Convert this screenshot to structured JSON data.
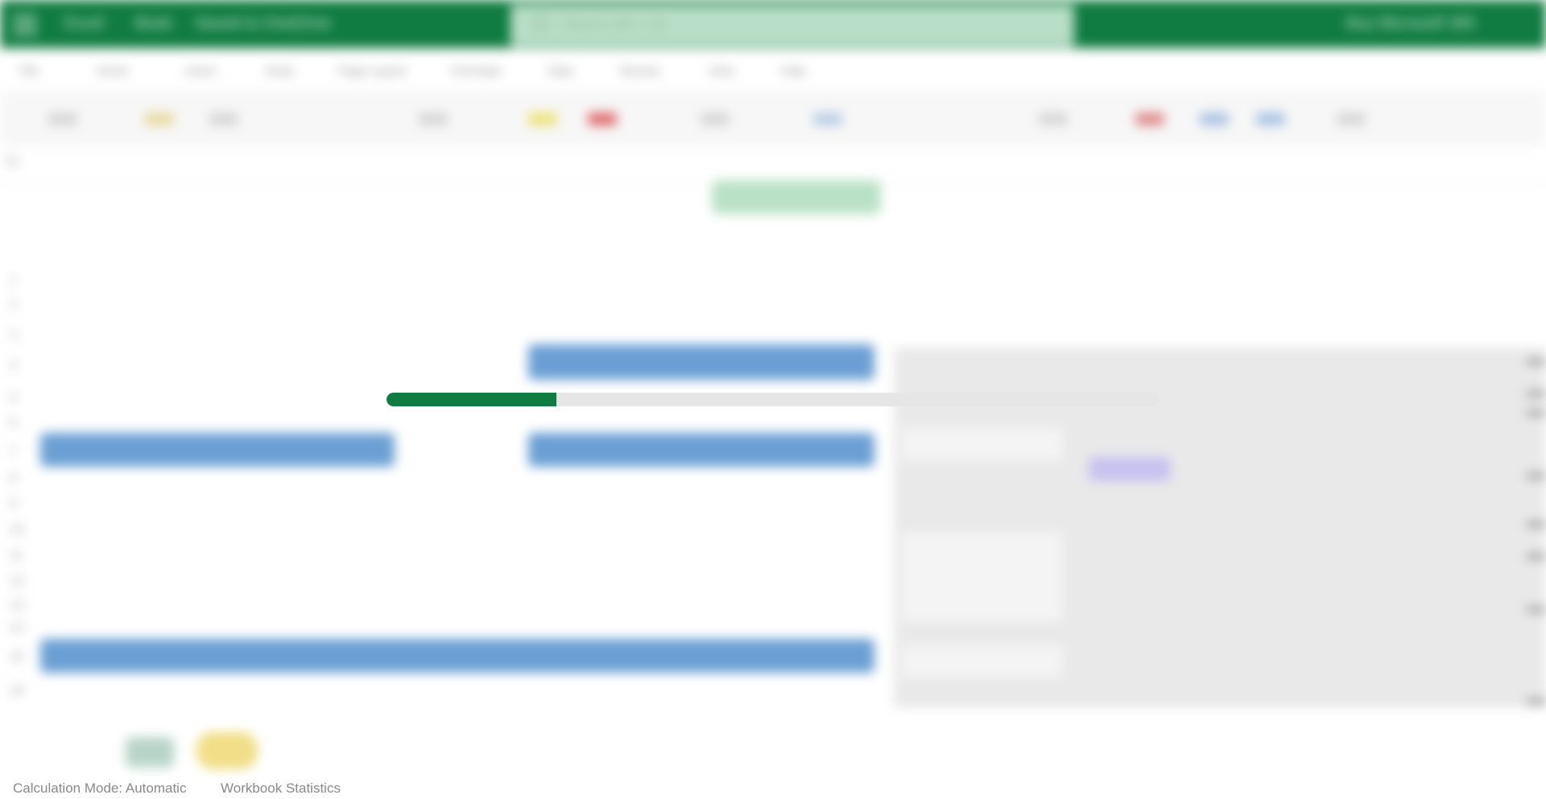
{
  "window": {
    "app_name": "Excel",
    "doc_name": "Book",
    "save_state": "Saved to OneDrive",
    "search_placeholder": "Search (Alt + Q)",
    "promo": "Buy Microsoft 365"
  },
  "ribbon": {
    "tabs": [
      "File",
      "Home",
      "Insert",
      "Draw",
      "Page Layout",
      "Formulas",
      "Data",
      "Review",
      "View",
      "Help"
    ]
  },
  "formula_bar": {
    "name_box": "A1"
  },
  "rows": [
    "1",
    "2",
    "3",
    "4",
    "5",
    "6",
    "7",
    "8",
    "9",
    "10",
    "11",
    "12",
    "13",
    "14",
    "15",
    "16"
  ],
  "loading": {
    "progress_fraction": 0.22,
    "colors": {
      "fill": "#107c41",
      "track": "#e6e6e6"
    }
  },
  "status_bar": {
    "calculation_mode": "Calculation Mode: Automatic",
    "workbook_statistics": "Workbook Statistics"
  },
  "colors": {
    "brand": "#107c41",
    "cell_blue": "#6b9fd4",
    "panel_gray": "#e9e9e9"
  }
}
